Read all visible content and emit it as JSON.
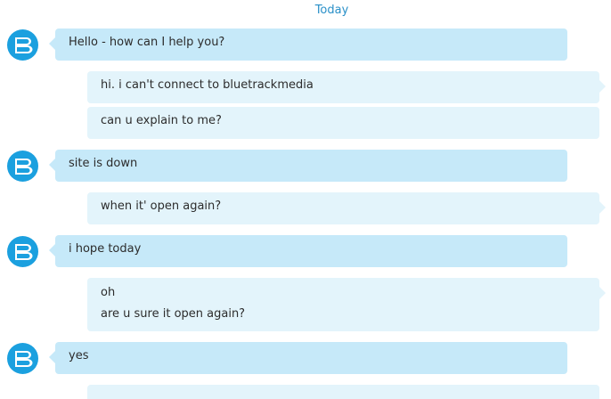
{
  "chat": {
    "date_header": "Today",
    "colors": {
      "incoming_bubble": "#c6e9f9",
      "outgoing_bubble": "#e3f4fb",
      "avatar": "#1ba0df",
      "date_header": "#2a90c8"
    },
    "avatar_icon": "bluetrack-b-logo-icon",
    "messages": [
      {
        "direction": "incoming",
        "lines": [
          "Hello - how can I help you?"
        ]
      },
      {
        "direction": "outgoing",
        "lines": [
          "hi. i can't connect to bluetrackmedia"
        ]
      },
      {
        "direction": "outgoing",
        "lines": [
          "can u explain to me?"
        ]
      },
      {
        "direction": "incoming",
        "lines": [
          "site is down"
        ]
      },
      {
        "direction": "outgoing",
        "lines": [
          "when it' open again?"
        ]
      },
      {
        "direction": "incoming",
        "lines": [
          "i hope today"
        ]
      },
      {
        "direction": "outgoing",
        "lines": [
          "oh",
          "are u sure it open again?"
        ]
      },
      {
        "direction": "incoming",
        "lines": [
          "yes"
        ]
      },
      {
        "direction": "outgoing",
        "lines": []
      }
    ]
  }
}
